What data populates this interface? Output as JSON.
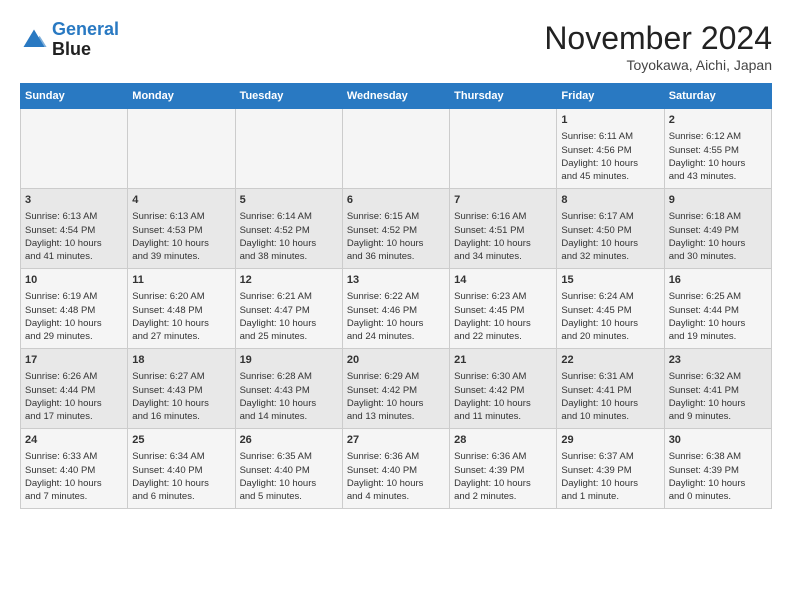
{
  "header": {
    "logo_line1": "General",
    "logo_line2": "Blue",
    "month": "November 2024",
    "location": "Toyokawa, Aichi, Japan"
  },
  "weekdays": [
    "Sunday",
    "Monday",
    "Tuesday",
    "Wednesday",
    "Thursday",
    "Friday",
    "Saturday"
  ],
  "weeks": [
    [
      {
        "day": "",
        "info": ""
      },
      {
        "day": "",
        "info": ""
      },
      {
        "day": "",
        "info": ""
      },
      {
        "day": "",
        "info": ""
      },
      {
        "day": "",
        "info": ""
      },
      {
        "day": "1",
        "info": "Sunrise: 6:11 AM\nSunset: 4:56 PM\nDaylight: 10 hours\nand 45 minutes."
      },
      {
        "day": "2",
        "info": "Sunrise: 6:12 AM\nSunset: 4:55 PM\nDaylight: 10 hours\nand 43 minutes."
      }
    ],
    [
      {
        "day": "3",
        "info": "Sunrise: 6:13 AM\nSunset: 4:54 PM\nDaylight: 10 hours\nand 41 minutes."
      },
      {
        "day": "4",
        "info": "Sunrise: 6:13 AM\nSunset: 4:53 PM\nDaylight: 10 hours\nand 39 minutes."
      },
      {
        "day": "5",
        "info": "Sunrise: 6:14 AM\nSunset: 4:52 PM\nDaylight: 10 hours\nand 38 minutes."
      },
      {
        "day": "6",
        "info": "Sunrise: 6:15 AM\nSunset: 4:52 PM\nDaylight: 10 hours\nand 36 minutes."
      },
      {
        "day": "7",
        "info": "Sunrise: 6:16 AM\nSunset: 4:51 PM\nDaylight: 10 hours\nand 34 minutes."
      },
      {
        "day": "8",
        "info": "Sunrise: 6:17 AM\nSunset: 4:50 PM\nDaylight: 10 hours\nand 32 minutes."
      },
      {
        "day": "9",
        "info": "Sunrise: 6:18 AM\nSunset: 4:49 PM\nDaylight: 10 hours\nand 30 minutes."
      }
    ],
    [
      {
        "day": "10",
        "info": "Sunrise: 6:19 AM\nSunset: 4:48 PM\nDaylight: 10 hours\nand 29 minutes."
      },
      {
        "day": "11",
        "info": "Sunrise: 6:20 AM\nSunset: 4:48 PM\nDaylight: 10 hours\nand 27 minutes."
      },
      {
        "day": "12",
        "info": "Sunrise: 6:21 AM\nSunset: 4:47 PM\nDaylight: 10 hours\nand 25 minutes."
      },
      {
        "day": "13",
        "info": "Sunrise: 6:22 AM\nSunset: 4:46 PM\nDaylight: 10 hours\nand 24 minutes."
      },
      {
        "day": "14",
        "info": "Sunrise: 6:23 AM\nSunset: 4:45 PM\nDaylight: 10 hours\nand 22 minutes."
      },
      {
        "day": "15",
        "info": "Sunrise: 6:24 AM\nSunset: 4:45 PM\nDaylight: 10 hours\nand 20 minutes."
      },
      {
        "day": "16",
        "info": "Sunrise: 6:25 AM\nSunset: 4:44 PM\nDaylight: 10 hours\nand 19 minutes."
      }
    ],
    [
      {
        "day": "17",
        "info": "Sunrise: 6:26 AM\nSunset: 4:44 PM\nDaylight: 10 hours\nand 17 minutes."
      },
      {
        "day": "18",
        "info": "Sunrise: 6:27 AM\nSunset: 4:43 PM\nDaylight: 10 hours\nand 16 minutes."
      },
      {
        "day": "19",
        "info": "Sunrise: 6:28 AM\nSunset: 4:43 PM\nDaylight: 10 hours\nand 14 minutes."
      },
      {
        "day": "20",
        "info": "Sunrise: 6:29 AM\nSunset: 4:42 PM\nDaylight: 10 hours\nand 13 minutes."
      },
      {
        "day": "21",
        "info": "Sunrise: 6:30 AM\nSunset: 4:42 PM\nDaylight: 10 hours\nand 11 minutes."
      },
      {
        "day": "22",
        "info": "Sunrise: 6:31 AM\nSunset: 4:41 PM\nDaylight: 10 hours\nand 10 minutes."
      },
      {
        "day": "23",
        "info": "Sunrise: 6:32 AM\nSunset: 4:41 PM\nDaylight: 10 hours\nand 9 minutes."
      }
    ],
    [
      {
        "day": "24",
        "info": "Sunrise: 6:33 AM\nSunset: 4:40 PM\nDaylight: 10 hours\nand 7 minutes."
      },
      {
        "day": "25",
        "info": "Sunrise: 6:34 AM\nSunset: 4:40 PM\nDaylight: 10 hours\nand 6 minutes."
      },
      {
        "day": "26",
        "info": "Sunrise: 6:35 AM\nSunset: 4:40 PM\nDaylight: 10 hours\nand 5 minutes."
      },
      {
        "day": "27",
        "info": "Sunrise: 6:36 AM\nSunset: 4:40 PM\nDaylight: 10 hours\nand 4 minutes."
      },
      {
        "day": "28",
        "info": "Sunrise: 6:36 AM\nSunset: 4:39 PM\nDaylight: 10 hours\nand 2 minutes."
      },
      {
        "day": "29",
        "info": "Sunrise: 6:37 AM\nSunset: 4:39 PM\nDaylight: 10 hours\nand 1 minute."
      },
      {
        "day": "30",
        "info": "Sunrise: 6:38 AM\nSunset: 4:39 PM\nDaylight: 10 hours\nand 0 minutes."
      }
    ]
  ]
}
